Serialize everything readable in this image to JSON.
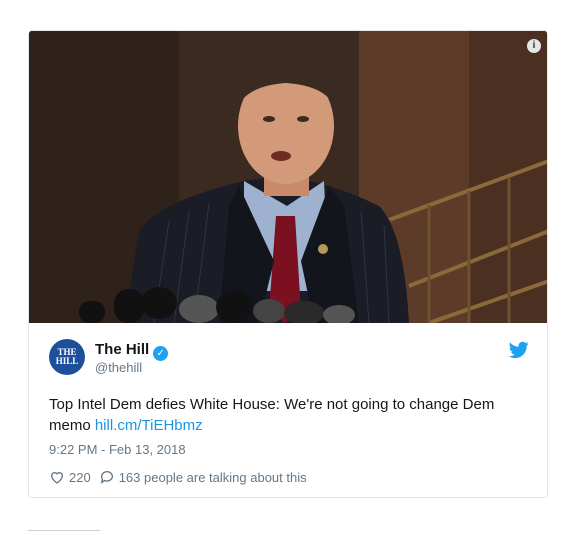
{
  "media": {
    "info_icon": "info-icon",
    "photo": "man-speaking-at-microphones-photo"
  },
  "author": {
    "avatar_text": "THE HILL",
    "name": "The Hill",
    "handle": "@thehill",
    "verified_icon": "verified-badge-icon",
    "brand_icon": "twitter-bird-icon"
  },
  "tweet": {
    "text_before": "Top Intel Dem defies White House: We're not going to change Dem memo ",
    "link": "hill.cm/TiEHbmz",
    "timestamp": "9:22 PM - Feb 13, 2018"
  },
  "actions": {
    "likes": "220",
    "talking": "163 people are talking about this",
    "like_icon": "heart-icon",
    "reply_icon": "speech-bubble-icon"
  },
  "colors": {
    "link": "#1b95e0",
    "verified": "#1da1f2",
    "muted": "#657786",
    "avatar_bg": "#1d4f9a"
  }
}
